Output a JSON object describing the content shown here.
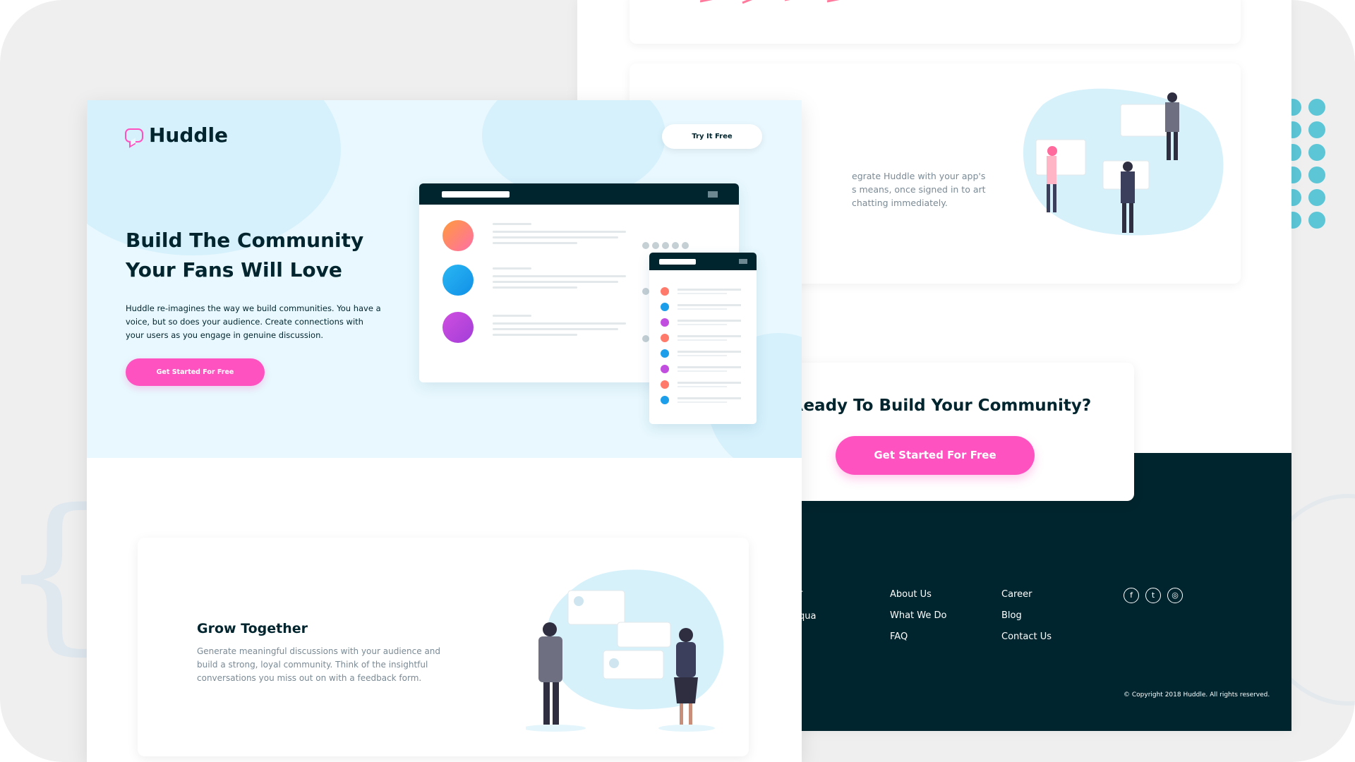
{
  "hero": {
    "logo": "Huddle",
    "try_button": "Try It Free",
    "title": "Build The Community Your Fans Will Love",
    "description": "Huddle re-imagines the way we build communities. You have a voice, but so does your audience. Create connections with your users as you engage in genuine discussion.",
    "cta": "Get Started For Free"
  },
  "features": {
    "grow_title": "Grow Together",
    "grow_desc": "Generate meaningful discussions with your audience and build a strong, loyal community. Think of the insightful conversations you miss out on with a feedback form.",
    "partial_text": "egrate Huddle with your app's s means, once signed in to art chatting immediately."
  },
  "cta": {
    "title": "Ready To Build Your Community?",
    "button": "Get Started For Free"
  },
  "footer": {
    "partial_1": "r",
    "partial_2": "qua",
    "col1": [
      "About Us",
      "What We Do",
      "FAQ"
    ],
    "col2": [
      "Career",
      "Blog",
      "Contact Us"
    ],
    "social": [
      "f",
      "t",
      "◎"
    ],
    "copyright": "© Copyright 2018 Huddle. All rights reserved."
  },
  "colors": {
    "pink": "#ff52c1",
    "dark_cyan": "#00252e",
    "hero_bg": "#e8f8fe"
  }
}
